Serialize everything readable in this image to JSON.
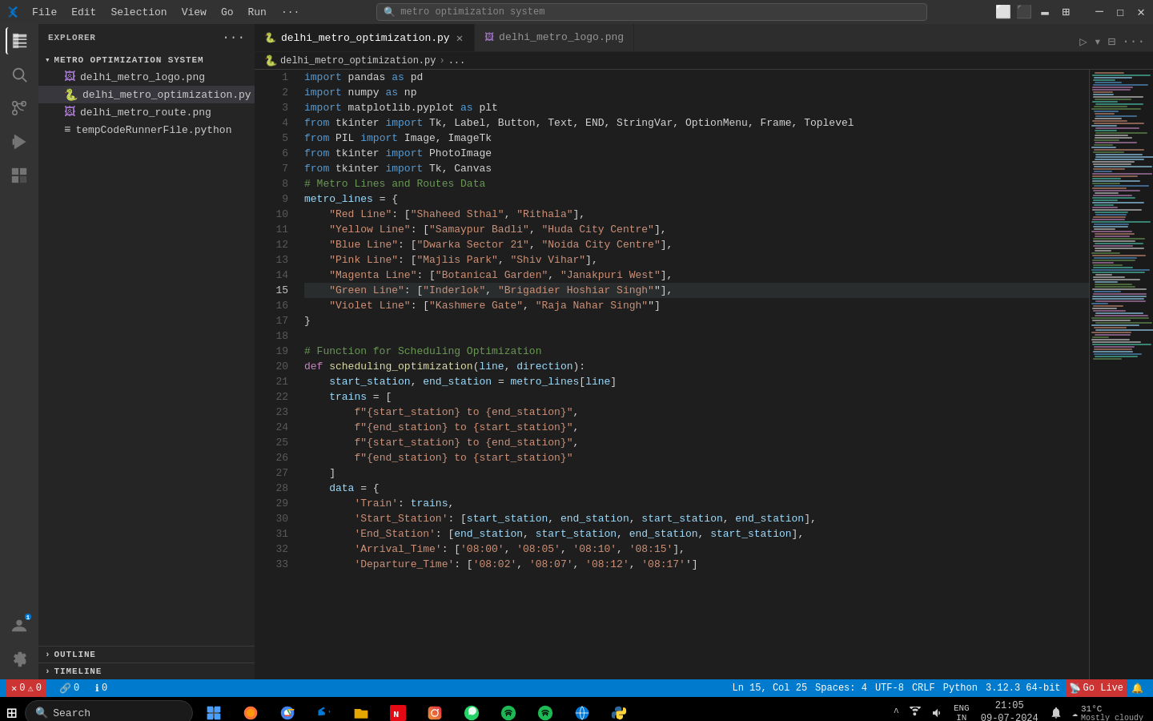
{
  "titlebar": {
    "menu_items": [
      "File",
      "Edit",
      "Selection",
      "View",
      "Go",
      "Run",
      "···"
    ],
    "search_placeholder": "metro optimization system",
    "win_buttons": [
      "—",
      "☐",
      "✕"
    ]
  },
  "tabs": [
    {
      "id": "tab1",
      "label": "delhi_metro_optimization.py",
      "icon": "🐍",
      "active": true,
      "modified": false
    },
    {
      "id": "tab2",
      "label": "delhi_metro_logo.png",
      "icon": "🖼",
      "active": false,
      "modified": false
    }
  ],
  "breadcrumb": {
    "file": "delhi_metro_optimization.py",
    "rest": "..."
  },
  "sidebar": {
    "title": "EXPLORER",
    "project": "METRO OPTIMIZATION SYSTEM",
    "files": [
      {
        "name": "delhi_metro_logo.png",
        "type": "png",
        "icon": "🖼"
      },
      {
        "name": "delhi_metro_optimization.py",
        "type": "py",
        "icon": "🐍",
        "active": true
      },
      {
        "name": "delhi_metro_route.png",
        "type": "png",
        "icon": "🖼"
      },
      {
        "name": "tempCodeRunnerFile.python",
        "type": "py",
        "icon": "📄"
      }
    ],
    "outline_label": "OUTLINE",
    "timeline_label": "TIMELINE"
  },
  "status_bar": {
    "branch": "Ln 15, Col 25",
    "spaces": "Spaces: 4",
    "encoding": "UTF-8",
    "line_ending": "CRLF",
    "language": "Python",
    "python_version": "3.12.3 64-bit",
    "go_live": "Go Live",
    "errors": "0",
    "warnings": "0",
    "info": "0",
    "remote": "0"
  },
  "taskbar": {
    "search_label": "Search",
    "time": "21:05",
    "date": "09-07-2024",
    "weather": "31°C",
    "weather_desc": "Mostly cloudy",
    "lang": "ENG\nIN"
  },
  "code_lines": [
    {
      "num": 1,
      "tokens": [
        {
          "t": "kw",
          "v": "import"
        },
        {
          "t": "plain",
          "v": " pandas "
        },
        {
          "t": "kw",
          "v": "as"
        },
        {
          "t": "plain",
          "v": " pd"
        }
      ]
    },
    {
      "num": 2,
      "tokens": [
        {
          "t": "kw",
          "v": "import"
        },
        {
          "t": "plain",
          "v": " numpy "
        },
        {
          "t": "kw",
          "v": "as"
        },
        {
          "t": "plain",
          "v": " np"
        }
      ]
    },
    {
      "num": 3,
      "tokens": [
        {
          "t": "kw",
          "v": "import"
        },
        {
          "t": "plain",
          "v": " matplotlib.pyplot "
        },
        {
          "t": "kw",
          "v": "as"
        },
        {
          "t": "plain",
          "v": " plt"
        }
      ]
    },
    {
      "num": 4,
      "tokens": [
        {
          "t": "kw",
          "v": "from"
        },
        {
          "t": "plain",
          "v": " tkinter "
        },
        {
          "t": "kw",
          "v": "import"
        },
        {
          "t": "plain",
          "v": " Tk, Label, Button, Text, END, StringVar, OptionMenu, Frame, Toplevel"
        }
      ]
    },
    {
      "num": 5,
      "tokens": [
        {
          "t": "kw",
          "v": "from"
        },
        {
          "t": "plain",
          "v": " PIL "
        },
        {
          "t": "kw",
          "v": "import"
        },
        {
          "t": "plain",
          "v": " Image, ImageTk"
        }
      ]
    },
    {
      "num": 6,
      "tokens": [
        {
          "t": "kw",
          "v": "from"
        },
        {
          "t": "plain",
          "v": " tkinter "
        },
        {
          "t": "kw",
          "v": "import"
        },
        {
          "t": "plain",
          "v": " PhotoImage"
        }
      ]
    },
    {
      "num": 7,
      "tokens": [
        {
          "t": "kw",
          "v": "from"
        },
        {
          "t": "plain",
          "v": " tkinter "
        },
        {
          "t": "kw",
          "v": "import"
        },
        {
          "t": "plain",
          "v": " Tk, Canvas"
        }
      ]
    },
    {
      "num": 8,
      "tokens": [
        {
          "t": "cm",
          "v": "# Metro Lines and Routes Data"
        }
      ]
    },
    {
      "num": 9,
      "tokens": [
        {
          "t": "var",
          "v": "metro_lines"
        },
        {
          "t": "plain",
          "v": " = {"
        }
      ]
    },
    {
      "num": 10,
      "tokens": [
        {
          "t": "plain",
          "v": "    "
        },
        {
          "t": "str",
          "v": "\"Red Line\""
        },
        {
          "t": "plain",
          "v": ": ["
        },
        {
          "t": "str",
          "v": "\"Shaheed Sthal\""
        },
        {
          "t": "plain",
          "v": ", "
        },
        {
          "t": "str",
          "v": "\"Rithala\""
        },
        {
          "t": "plain",
          "v": "],"
        }
      ]
    },
    {
      "num": 11,
      "tokens": [
        {
          "t": "plain",
          "v": "    "
        },
        {
          "t": "str",
          "v": "\"Yellow Line\""
        },
        {
          "t": "plain",
          "v": ": ["
        },
        {
          "t": "str",
          "v": "\"Samaypur Badli\""
        },
        {
          "t": "plain",
          "v": ", "
        },
        {
          "t": "str",
          "v": "\"Huda City Centre\""
        },
        {
          "t": "plain",
          "v": "],"
        }
      ]
    },
    {
      "num": 12,
      "tokens": [
        {
          "t": "plain",
          "v": "    "
        },
        {
          "t": "str",
          "v": "\"Blue Line\""
        },
        {
          "t": "plain",
          "v": ": ["
        },
        {
          "t": "str",
          "v": "\"Dwarka Sector 21\""
        },
        {
          "t": "plain",
          "v": ", "
        },
        {
          "t": "str",
          "v": "\"Noida City Centre\""
        },
        {
          "t": "plain",
          "v": "],"
        }
      ]
    },
    {
      "num": 13,
      "tokens": [
        {
          "t": "plain",
          "v": "    "
        },
        {
          "t": "str",
          "v": "\"Pink Line\""
        },
        {
          "t": "plain",
          "v": ": ["
        },
        {
          "t": "str",
          "v": "\"Majlis Park\""
        },
        {
          "t": "plain",
          "v": ", "
        },
        {
          "t": "str",
          "v": "\"Shiv Vihar\""
        },
        {
          "t": "plain",
          "v": "],"
        }
      ]
    },
    {
      "num": 14,
      "tokens": [
        {
          "t": "plain",
          "v": "    "
        },
        {
          "t": "str",
          "v": "\"Magenta Line\""
        },
        {
          "t": "plain",
          "v": ": ["
        },
        {
          "t": "str",
          "v": "\"Botanical Garden\""
        },
        {
          "t": "plain",
          "v": ", "
        },
        {
          "t": "str",
          "v": "\"Janakpuri West\""
        },
        {
          "t": "plain",
          "v": "],"
        }
      ]
    },
    {
      "num": 15,
      "tokens": [
        {
          "t": "plain",
          "v": "    "
        },
        {
          "t": "str",
          "v": "\"Green Line\""
        },
        {
          "t": "plain",
          "v": ": ["
        },
        {
          "t": "str",
          "v": "\"Inderlok\""
        },
        {
          "t": "plain",
          "v": ", "
        },
        {
          "t": "str",
          "v": "\"Brigadier Hoshiar Singh\""
        },
        {
          "t": "plain",
          "v": "\"],"
        },
        {
          "t": "plain",
          "v": ""
        }
      ],
      "highlight": true
    },
    {
      "num": 16,
      "tokens": [
        {
          "t": "plain",
          "v": "    "
        },
        {
          "t": "str",
          "v": "\"Violet Line\""
        },
        {
          "t": "plain",
          "v": ": ["
        },
        {
          "t": "str",
          "v": "\"Kashmere Gate\""
        },
        {
          "t": "plain",
          "v": ", "
        },
        {
          "t": "str",
          "v": "\"Raja Nahar Singh\""
        },
        {
          "t": "plain",
          "v": "\"]"
        }
      ]
    },
    {
      "num": 17,
      "tokens": [
        {
          "t": "plain",
          "v": "}"
        }
      ]
    },
    {
      "num": 18,
      "tokens": [
        {
          "t": "plain",
          "v": ""
        }
      ]
    },
    {
      "num": 19,
      "tokens": [
        {
          "t": "cm",
          "v": "# Function for Scheduling Optimization"
        }
      ]
    },
    {
      "num": 20,
      "tokens": [
        {
          "t": "kw2",
          "v": "def"
        },
        {
          "t": "plain",
          "v": " "
        },
        {
          "t": "fn",
          "v": "scheduling_optimization"
        },
        {
          "t": "plain",
          "v": "("
        },
        {
          "t": "var",
          "v": "line"
        },
        {
          "t": "plain",
          "v": ", "
        },
        {
          "t": "var",
          "v": "direction"
        },
        {
          "t": "plain",
          "v": "):"
        }
      ]
    },
    {
      "num": 21,
      "tokens": [
        {
          "t": "plain",
          "v": "    "
        },
        {
          "t": "var",
          "v": "start_station"
        },
        {
          "t": "plain",
          "v": ", "
        },
        {
          "t": "var",
          "v": "end_station"
        },
        {
          "t": "plain",
          "v": " = "
        },
        {
          "t": "var",
          "v": "metro_lines"
        },
        {
          "t": "plain",
          "v": "["
        },
        {
          "t": "var",
          "v": "line"
        },
        {
          "t": "plain",
          "v": "]"
        }
      ]
    },
    {
      "num": 22,
      "tokens": [
        {
          "t": "plain",
          "v": "    "
        },
        {
          "t": "var",
          "v": "trains"
        },
        {
          "t": "plain",
          "v": " = ["
        }
      ]
    },
    {
      "num": 23,
      "tokens": [
        {
          "t": "plain",
          "v": "        "
        },
        {
          "t": "str",
          "v": "f\"{start_station} to {end_station}\""
        },
        {
          "t": "plain",
          "v": ","
        }
      ]
    },
    {
      "num": 24,
      "tokens": [
        {
          "t": "plain",
          "v": "        "
        },
        {
          "t": "str",
          "v": "f\"{end_station} to {start_station}\""
        },
        {
          "t": "plain",
          "v": ","
        }
      ]
    },
    {
      "num": 25,
      "tokens": [
        {
          "t": "plain",
          "v": "        "
        },
        {
          "t": "str",
          "v": "f\"{start_station} to {end_station}\""
        },
        {
          "t": "plain",
          "v": ","
        }
      ]
    },
    {
      "num": 26,
      "tokens": [
        {
          "t": "plain",
          "v": "        "
        },
        {
          "t": "str",
          "v": "f\"{end_station} to {start_station}\""
        }
      ]
    },
    {
      "num": 27,
      "tokens": [
        {
          "t": "plain",
          "v": "    ]"
        }
      ]
    },
    {
      "num": 28,
      "tokens": [
        {
          "t": "plain",
          "v": "    "
        },
        {
          "t": "var",
          "v": "data"
        },
        {
          "t": "plain",
          "v": " = {"
        }
      ]
    },
    {
      "num": 29,
      "tokens": [
        {
          "t": "plain",
          "v": "        "
        },
        {
          "t": "str",
          "v": "'Train'"
        },
        {
          "t": "plain",
          "v": ": "
        },
        {
          "t": "var",
          "v": "trains"
        },
        {
          "t": "plain",
          "v": ","
        }
      ]
    },
    {
      "num": 30,
      "tokens": [
        {
          "t": "plain",
          "v": "        "
        },
        {
          "t": "str",
          "v": "'Start_Station'"
        },
        {
          "t": "plain",
          "v": ": ["
        },
        {
          "t": "var",
          "v": "start_station"
        },
        {
          "t": "plain",
          "v": ", "
        },
        {
          "t": "var",
          "v": "end_station"
        },
        {
          "t": "plain",
          "v": ", "
        },
        {
          "t": "var",
          "v": "start_station"
        },
        {
          "t": "plain",
          "v": ", "
        },
        {
          "t": "var",
          "v": "end_station"
        },
        {
          "t": "plain",
          "v": "],"
        }
      ]
    },
    {
      "num": 31,
      "tokens": [
        {
          "t": "plain",
          "v": "        "
        },
        {
          "t": "str",
          "v": "'End_Station'"
        },
        {
          "t": "plain",
          "v": ": ["
        },
        {
          "t": "var",
          "v": "end_station"
        },
        {
          "t": "plain",
          "v": ", "
        },
        {
          "t": "var",
          "v": "start_station"
        },
        {
          "t": "plain",
          "v": ", "
        },
        {
          "t": "var",
          "v": "end_station"
        },
        {
          "t": "plain",
          "v": ", "
        },
        {
          "t": "var",
          "v": "start_station"
        },
        {
          "t": "plain",
          "v": "],"
        }
      ]
    },
    {
      "num": 32,
      "tokens": [
        {
          "t": "plain",
          "v": "        "
        },
        {
          "t": "str",
          "v": "'Arrival_Time'"
        },
        {
          "t": "plain",
          "v": ": ["
        },
        {
          "t": "str",
          "v": "'08:00'"
        },
        {
          "t": "plain",
          "v": ", "
        },
        {
          "t": "str",
          "v": "'08:05'"
        },
        {
          "t": "plain",
          "v": ", "
        },
        {
          "t": "str",
          "v": "'08:10'"
        },
        {
          "t": "plain",
          "v": ", "
        },
        {
          "t": "str",
          "v": "'08:15'"
        },
        {
          "t": "plain",
          "v": "],"
        }
      ]
    },
    {
      "num": 33,
      "tokens": [
        {
          "t": "plain",
          "v": "        "
        },
        {
          "t": "str",
          "v": "'Departure_Time'"
        },
        {
          "t": "plain",
          "v": ": ["
        },
        {
          "t": "str",
          "v": "'08:02'"
        },
        {
          "t": "plain",
          "v": ", "
        },
        {
          "t": "str",
          "v": "'08:07'"
        },
        {
          "t": "plain",
          "v": ", "
        },
        {
          "t": "str",
          "v": "'08:12'"
        },
        {
          "t": "plain",
          "v": ", "
        },
        {
          "t": "str",
          "v": "'08:17'"
        },
        {
          "t": "plain",
          "v": "']"
        }
      ]
    }
  ]
}
